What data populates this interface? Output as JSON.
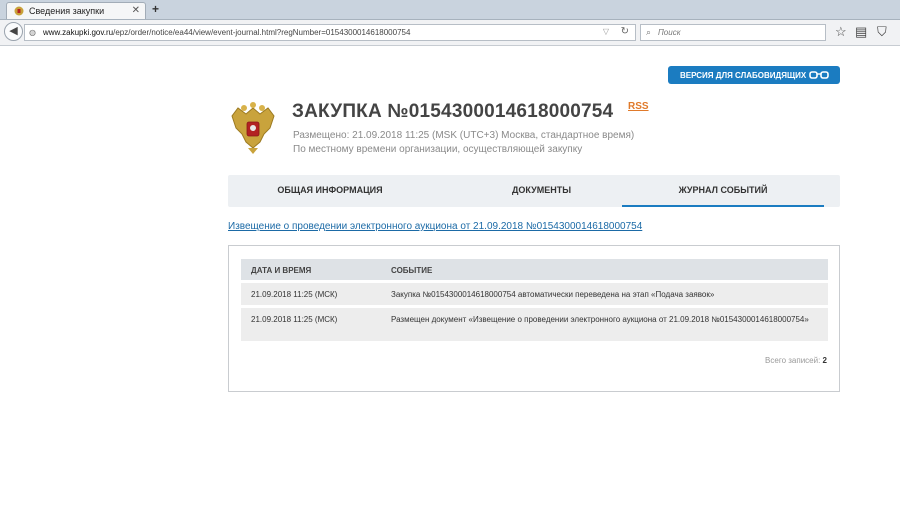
{
  "browser": {
    "tab_title": "Сведения закупки",
    "url_domain": "www.zakupki.gov.ru",
    "url_path": "/epz/order/notice/ea44/view/event-journal.html?regNumber=0154300014618000754",
    "search_placeholder": "Поиск"
  },
  "header": {
    "vision_button_label": "ВЕРСИЯ ДЛЯ СЛАБОВИДЯЩИХ",
    "title": "ЗАКУПКА №0154300014618000754",
    "rss_label": "RSS",
    "posted_line": "Размещено: 21.09.2018 11:25 (MSK (UTC+3) Москва, стандартное время)",
    "timezone_note": "По местному времени организации, осуществляющей закупку"
  },
  "tabs": [
    {
      "label": "ОБЩАЯ ИНФОРМАЦИЯ",
      "active": false
    },
    {
      "label": "ДОКУМЕНТЫ",
      "active": false
    },
    {
      "label": "ЖУРНАЛ СОБЫТИЙ",
      "active": true
    }
  ],
  "notice_link": "Извещение о проведении электронного аукциона от 21.09.2018 №0154300014618000754",
  "events_table": {
    "columns": [
      "ДАТА И ВРЕМЯ",
      "СОБЫТИЕ"
    ],
    "rows": [
      {
        "datetime": "21.09.2018 11:25 (МСК)",
        "event": "Закупка №0154300014618000754 автоматически переведена на этап «Подача заявок»"
      },
      {
        "datetime": "21.09.2018 11:25 (МСК)",
        "event": "Размещен документ «Извещение о проведении электронного аукциона от 21.09.2018 №0154300014618000754»"
      }
    ],
    "total_label": "Всего записей:",
    "total_count": "2"
  },
  "colors": {
    "accent": "#1b7cc1",
    "link": "#1b6aa6",
    "rss": "#e07a2b",
    "tabs_bg": "#edf0f3"
  }
}
